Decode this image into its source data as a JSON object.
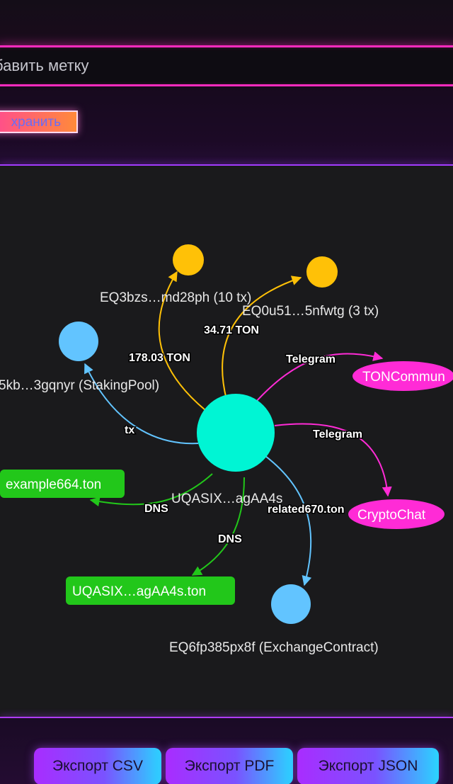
{
  "label_editor": {
    "placeholder": "бавить метку",
    "save_label": "хранить"
  },
  "graph": {
    "colors": {
      "center": "#00f5d4",
      "transaction": "#ffc107",
      "contract": "#62c4ff",
      "telegram": "#ff2bd6",
      "dns": "#22c71a"
    },
    "center_label": "UQASIX…agAA4s",
    "nodes": [
      {
        "id": "tx1",
        "label": "EQ3bzs…md28ph (10 tx)"
      },
      {
        "id": "tx2",
        "label": "EQ0u51…5nfwtg (3 tx)"
      },
      {
        "id": "pool",
        "label": "5kb…3gqnyr (StakingPool)"
      },
      {
        "id": "exchange",
        "label": "EQ6fp385px8f (ExchangeContract)"
      },
      {
        "id": "tg1",
        "label": "TONCommun"
      },
      {
        "id": "tg2",
        "label": "CryptoChat"
      },
      {
        "id": "dns1",
        "label": "example664.ton"
      },
      {
        "id": "dns2",
        "label": "UQASIX…agAA4s.ton"
      }
    ],
    "edges": [
      {
        "to": "tx1",
        "label": "178.03 TON"
      },
      {
        "to": "tx2",
        "label": "34.71 TON"
      },
      {
        "to": "pool",
        "label": "tx"
      },
      {
        "to": "tg1",
        "label": "Telegram"
      },
      {
        "to": "tg2",
        "label": "Telegram"
      },
      {
        "to": "exchange",
        "label": "related670.ton"
      },
      {
        "to": "dns1",
        "label": "DNS"
      },
      {
        "to": "dns2",
        "label": "DNS"
      }
    ]
  },
  "export": {
    "csv": "Экспорт CSV",
    "pdf": "Экспорт PDF",
    "json": "Экспорт JSON"
  }
}
